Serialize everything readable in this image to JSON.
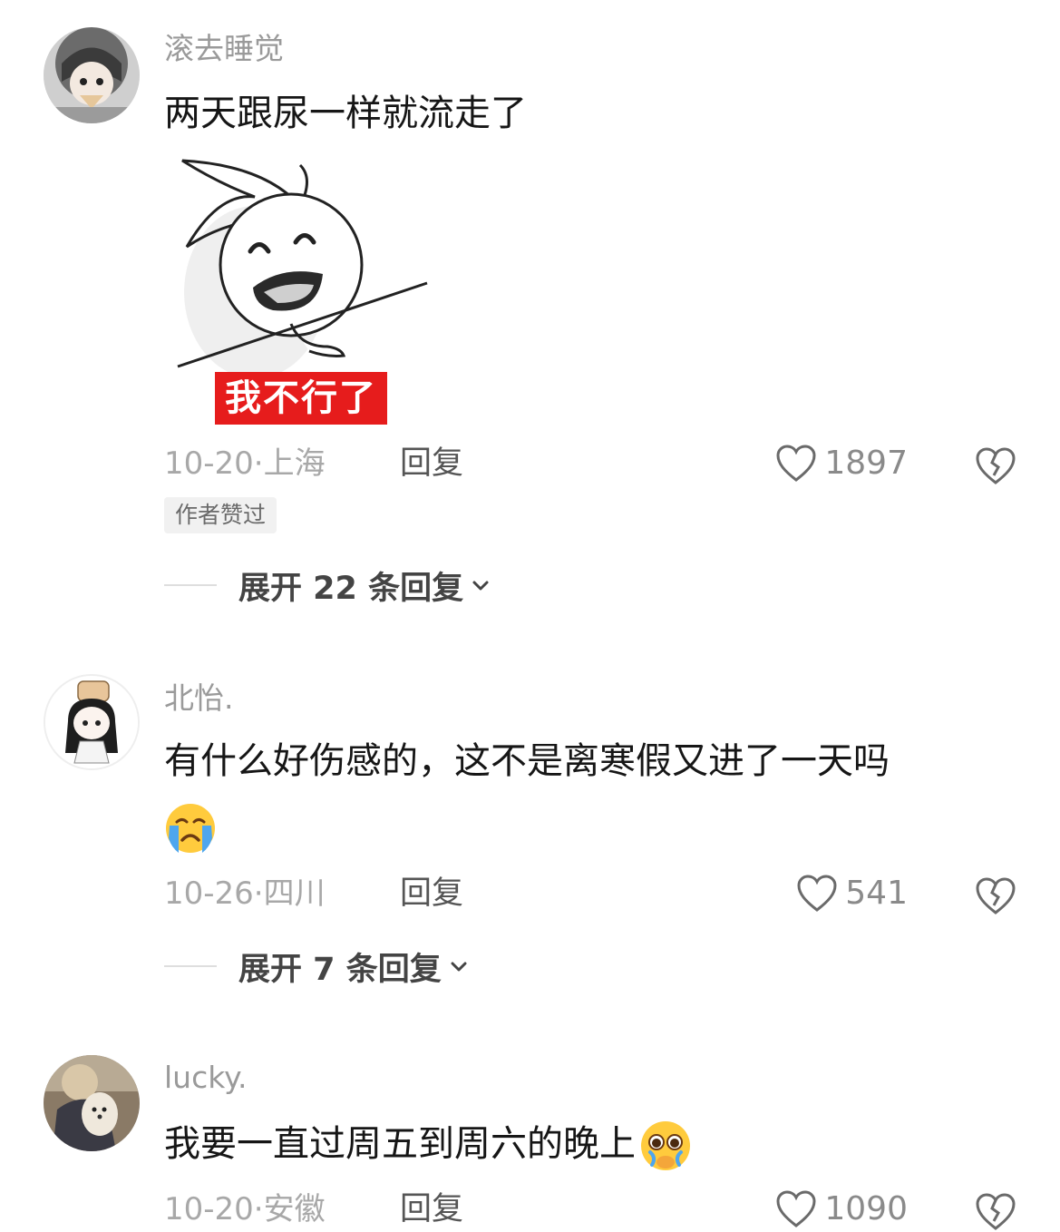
{
  "comments": [
    {
      "username": "滚去睡觉",
      "text": "两天跟尿一样就流走了",
      "sticker_caption": "我不行了",
      "date_location": "10-20·上海",
      "reply_label": "回复",
      "likes": "1897",
      "badge": "作者赞过",
      "expand_label": "展开 22 条回复"
    },
    {
      "username": "北怡.",
      "text": "有什么好伤感的，这不是离寒假又进了一天吗",
      "emoji": "crying-face-emoji",
      "date_location": "10-26·四川",
      "reply_label": "回复",
      "likes": "541",
      "expand_label": "展开 7 条回复"
    },
    {
      "username": "lucky.",
      "text": "我要一直过周五到周六的晚上",
      "emoji": "pleading-face-emoji",
      "date_location": "10-20·安徽",
      "reply_label": "回复",
      "likes": "1090"
    }
  ],
  "icons": {
    "like": "heart-outline-icon",
    "dislike": "broken-heart-icon",
    "expand": "chevron-down-icon"
  },
  "colors": {
    "sticker_caption_bg": "#e61c1c",
    "meta_text": "#a8a8a8",
    "username": "#9a9a9a"
  }
}
